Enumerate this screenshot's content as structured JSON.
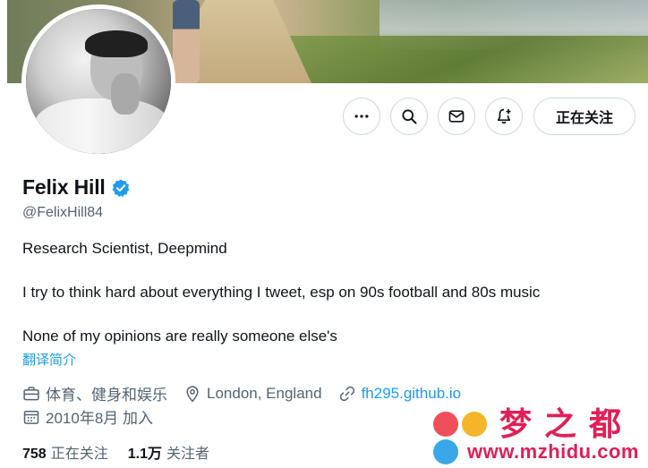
{
  "profile": {
    "name": "Felix Hill",
    "handle": "@FelixHill84",
    "bio_lines": [
      "Research Scientist, Deepmind",
      "I try to think hard about everything I tweet, esp on 90s football and 80s music",
      "None of my opinions are really someone else's"
    ],
    "translate_label": "翻译简介",
    "category": "体育、健身和娱乐",
    "location": "London, England",
    "website": "fh295.github.io",
    "joined": "2010年8月 加入"
  },
  "actions": {
    "more_icon": "more-icon",
    "search_icon": "search-icon",
    "message_icon": "mail-icon",
    "notify_icon": "bell-plus-icon",
    "following_label": "正在关注"
  },
  "stats": {
    "following_count": "758",
    "following_label": "正在关注",
    "followers_count": "1.1万",
    "followers_label": "关注者"
  },
  "watermark": {
    "text": "梦之都",
    "url": "www.mzhidu.com"
  },
  "colors": {
    "accent": "#1d9bf0",
    "verified": "#1d9bf0",
    "secondary_text": "#536471",
    "primary_text": "#0f1419",
    "watermark": "#e01f57"
  }
}
